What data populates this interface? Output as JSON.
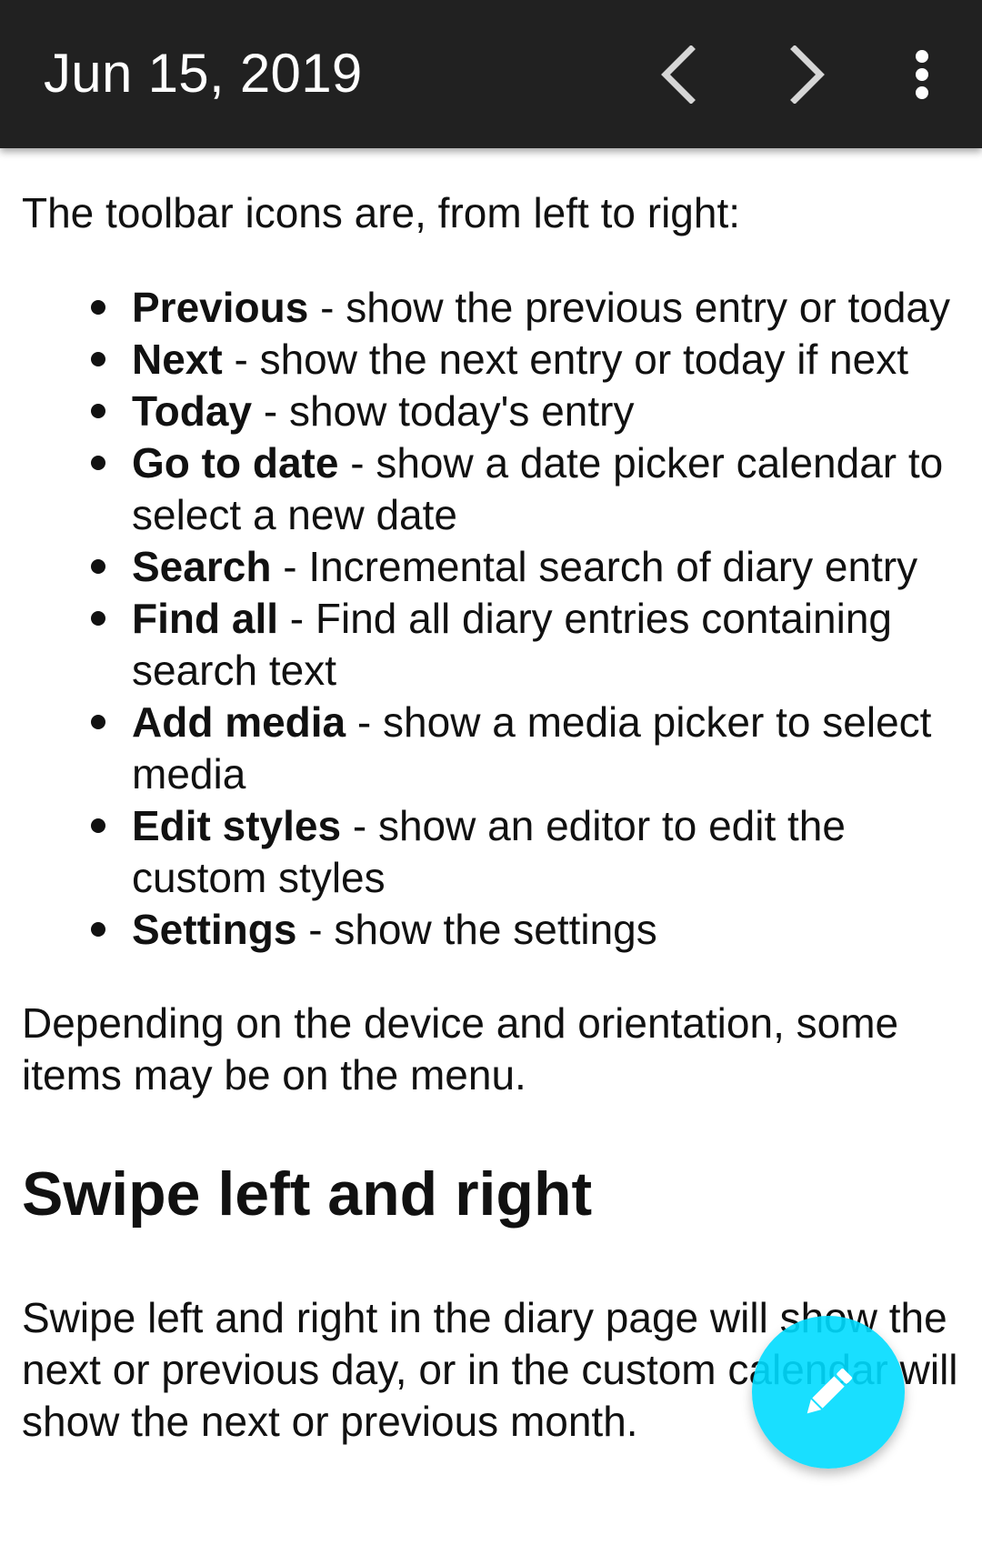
{
  "app_bar": {
    "title": "Jun 15, 2019",
    "background": "#212121",
    "icons": {
      "previous": "chevron-left-icon",
      "next": "chevron-right-icon",
      "overflow": "more-vertical-icon"
    }
  },
  "content": {
    "intro": "The toolbar icons are, from left to right:",
    "items": [
      {
        "term": "Previous",
        "desc": " - show the previous entry or today"
      },
      {
        "term": "Next",
        "desc": " - show the next entry or today if next"
      },
      {
        "term": "Today",
        "desc": " - show today's entry"
      },
      {
        "term": "Go to date",
        "desc": " - show a date picker calendar to select a new date"
      },
      {
        "term": "Search",
        "desc": " - Incremental search of diary entry"
      },
      {
        "term": "Find all",
        "desc": " - Find all diary entries containing search text"
      },
      {
        "term": "Add media",
        "desc": " - show a media picker to select media"
      },
      {
        "term": "Edit styles",
        "desc": " - show an editor to edit the custom styles"
      },
      {
        "term": "Settings",
        "desc": " - show the settings"
      }
    ],
    "after_list": "Depending on the device and orientation, some items may be on the menu.",
    "heading": "Swipe left and right",
    "swipe_text": "Swipe left and right in the diary page will show the next or previous day, or in the custom calendar will show the next or previous month."
  },
  "fab": {
    "icon": "pencil-icon",
    "color": "#00DCFF"
  }
}
